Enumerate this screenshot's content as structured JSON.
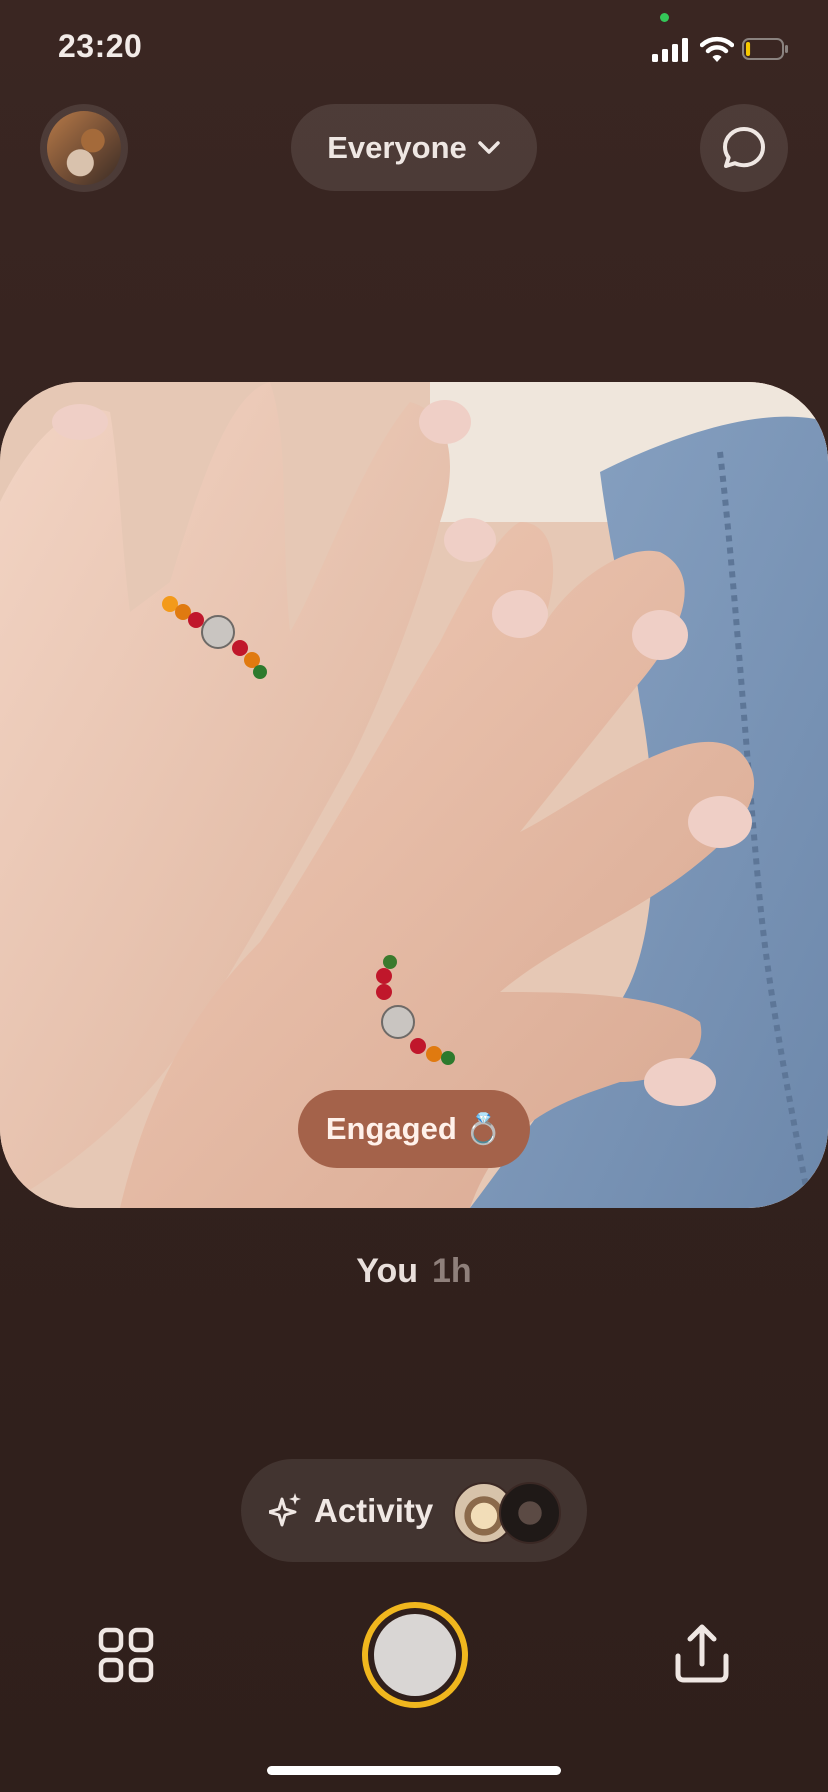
{
  "status_bar": {
    "time": "23:20",
    "battery_level": 0.12,
    "battery_color": "#f6c800",
    "privacy_dot_color": "#34c759"
  },
  "header": {
    "audience_label": "Everyone",
    "profile_icon": "profile-avatar",
    "chat_icon": "chat-bubble-icon",
    "audience_icon": "chevron-down-icon"
  },
  "post": {
    "caption": "Engaged",
    "caption_emoji": "💍",
    "caption_color": "#a4624a",
    "author": "You",
    "age": "1h"
  },
  "activity": {
    "label": "Activity",
    "icon": "sparkle-icon",
    "avatar_count": 2
  },
  "toolbar": {
    "grid_icon": "grid-icon",
    "shutter_icon": "shutter-button",
    "share_icon": "share-icon",
    "shutter_ring_color": "#f0b71e"
  }
}
